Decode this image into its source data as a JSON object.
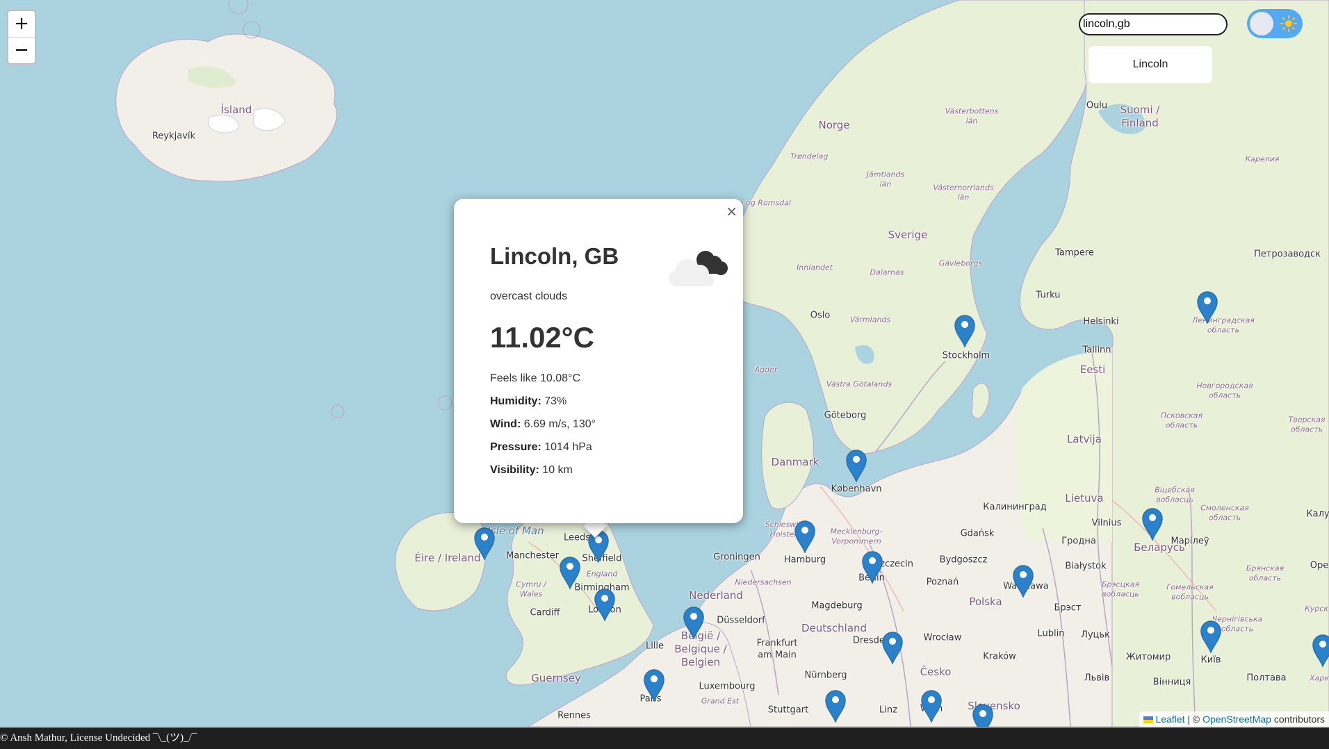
{
  "zoom": {
    "in_label": "+",
    "out_label": "−"
  },
  "search": {
    "value": "lincoln,gb"
  },
  "suggestions": [
    "Lincoln"
  ],
  "theme": {
    "mode": "light",
    "icon": "sun-icon",
    "accent": "#54a9f0"
  },
  "popup": {
    "close_label": "×",
    "city": "Lincoln, GB",
    "icon": "overcast-clouds-icon",
    "conditions": "overcast clouds",
    "temperature": "11.02°C",
    "feels_like": "Feels like 10.08°C",
    "humidity_label": "Humidity:",
    "humidity": "73%",
    "wind_label": "Wind:",
    "wind": "6.69 m/s, 130°",
    "pressure_label": "Pressure:",
    "pressure": "1014 hPa",
    "visibility_label": "Visibility:",
    "visibility": "10 km"
  },
  "map_labels": {
    "island": "Ísland",
    "reykjavik": "Reykjavík",
    "norge": "Norge",
    "sverige": "Sverige",
    "suomi": "Suomi /",
    "finland": "Finland",
    "oulu": "Oulu",
    "vasterbotten": "Västerbottens",
    "lan": "län",
    "trondelag": "Trøndelag",
    "jamtlands": "Jämtlands",
    "vasternorrlands": "Västernorrlands",
    "more_romsdal": "Møre og Romsdal",
    "innlandet": "Innlandet",
    "dalarnas": "Dalarnas",
    "gavleborgs": "Gävleborgs",
    "tampere": "Tampere",
    "petrozavodsk": "Петрозаводск",
    "karelia": "Карелия",
    "turku": "Turku",
    "helsinki": "Helsinki",
    "tallinn": "Tallinn",
    "eesti": "Eesti",
    "oslo": "Oslo",
    "varmlands": "Värmlands",
    "stockholm": "Stockholm",
    "agder": "Agder",
    "vastra_gotalands": "Västra Götalands",
    "goteborg": "Göteborg",
    "latvija": "Latvija",
    "danmark": "Danmark",
    "kobenhavn": "København",
    "lietuva": "Lietuva",
    "kaliningrad": "Калининград",
    "gdansk": "Gdańsk",
    "vilnius": "Vilnius",
    "belarus": "Беларусь",
    "isle_of_man": "Isle of Man",
    "leeds": "Leeds",
    "manchester": "Manchester",
    "sheffield": "Sheffield",
    "eire": "Éire / Ireland",
    "england": "England",
    "birmingham": "Birmingham",
    "cymru": "Cymru /",
    "wales": "Wales",
    "cardiff": "Cardiff",
    "london": "London",
    "hamburg": "Hamburg",
    "groningen": "Groningen",
    "niedersachsen": "Niedersachsen",
    "nederland": "Nederland",
    "berlin": "Berlin",
    "szczecin": "Szczecin",
    "bydgoszcz": "Bydgoszcz",
    "poznan": "Poznań",
    "warszawa": "Warszawa",
    "polska": "Polska",
    "bialystok": "Białystok",
    "grodno": "Гродна",
    "deutschland": "Deutschland",
    "magdeburg": "Magdeburg",
    "dusseldorf": "Düsseldorf",
    "belgie": "België /",
    "belgique": "Belgique /",
    "belgien": "Belgien",
    "lille": "Lille",
    "frankfurt": "Frankfurt",
    "am_main": "am Main",
    "dresden": "Dresden",
    "wroclaw": "Wrocław",
    "cesko": "Česko",
    "lublin": "Lublin",
    "krakow": "Kraków",
    "guernsey": "Guernsey",
    "luxembourg": "Luxembourg",
    "nurnberg": "Nürnberg",
    "paris": "Paris",
    "rennes": "Rennes",
    "stuttgart": "Stuttgart",
    "linz": "Linz",
    "wien": "Wien",
    "slovensko": "Slovensko",
    "kyiv": "Київ",
    "zhytomyr": "Житомир",
    "lviv": "Львів",
    "vinnytsia": "Вінниця",
    "poltava": "Полтава",
    "brest": "Брэст",
    "lutsk": "Луцьк",
    "leningrad": "Ленинградская",
    "oblast": "область",
    "pskov": "Псковская",
    "novgorod": "Новгородская",
    "tver": "Тверская",
    "mecklenburg": "Mecklenburg-",
    "vorpommern": "Vorpommern",
    "schleswig": "Schleswig-",
    "holstein": "Holstein",
    "grand_est": "Grand Est",
    "marileu": "Марілеў",
    "smolensk": "Смоленская",
    "bryansk": "Брянская",
    "gomel": "Гомельская",
    "vitebsk": "Віцебская",
    "brest_obl": "Брэсцкая",
    "vobl": "вобласць",
    "chernihiv": "Чернігівська",
    "ore": "Оре",
    "kalu": "Калу",
    "kursk": "Курск",
    "khark": "Харк"
  },
  "attribution": {
    "leaflet": "Leaflet",
    "separator": "| ©",
    "osm": "OpenStreetMap",
    "contributors": "contributors"
  },
  "footer": {
    "text": "© Ansh Mathur, License Undecided ¯\\_(ツ)_/¯"
  }
}
